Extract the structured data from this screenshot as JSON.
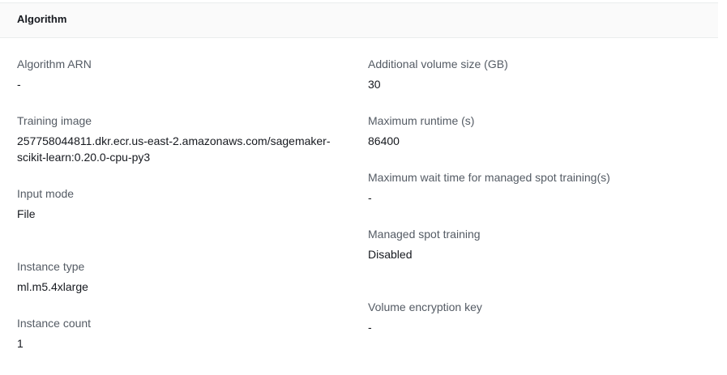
{
  "section": {
    "title": "Algorithm"
  },
  "left_fields": [
    {
      "label": "Algorithm ARN",
      "value": "-"
    },
    {
      "label": "Training image",
      "value": "257758044811.dkr.ecr.us-east-2.amazonaws.com/sagemaker-scikit-learn:0.20.0-cpu-py3"
    },
    {
      "label": "Input mode",
      "value": "File"
    },
    {
      "label": "Instance type",
      "value": "ml.m5.4xlarge"
    },
    {
      "label": "Instance count",
      "value": "1"
    }
  ],
  "right_fields": [
    {
      "label": "Additional volume size (GB)",
      "value": "30"
    },
    {
      "label": "Maximum runtime (s)",
      "value": "86400"
    },
    {
      "label": "Maximum wait time for managed spot training(s)",
      "value": "-"
    },
    {
      "label": "Managed spot training",
      "value": "Disabled"
    },
    {
      "label": "Volume encryption key",
      "value": "-"
    }
  ]
}
